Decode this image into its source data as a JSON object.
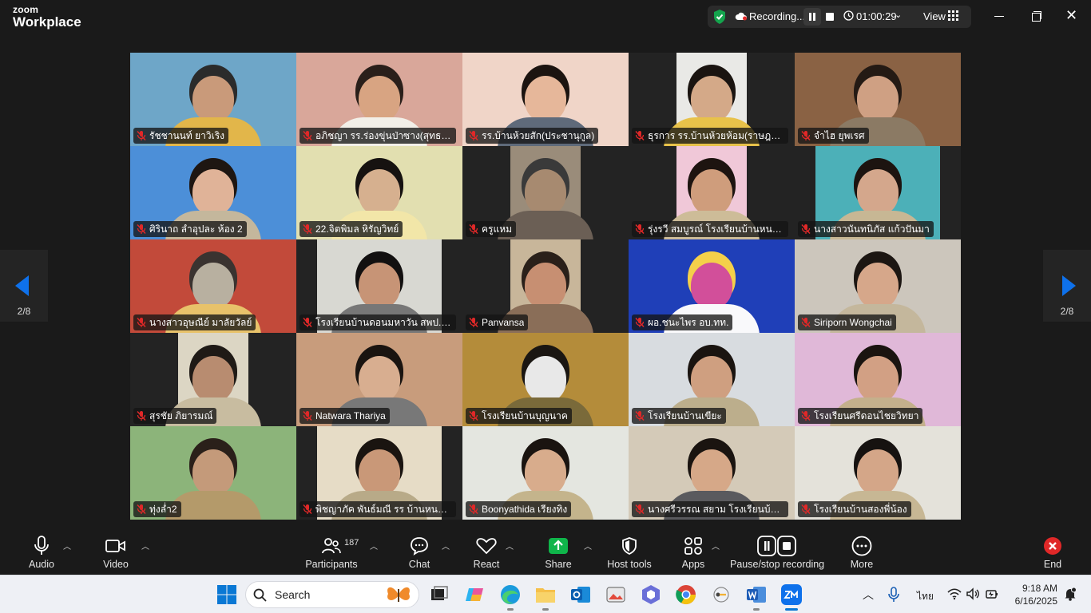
{
  "app": {
    "logo_line1": "zoom",
    "logo_line2": "Workplace"
  },
  "recording": {
    "label": "Recording...",
    "timer": "01:00:29",
    "view_label": "View"
  },
  "pagination": {
    "left": "2/8",
    "right": "2/8"
  },
  "participants": [
    {
      "name": "รัชชานนท์ ยาวิเริง"
    },
    {
      "name": "อภิชญา รร.ร่องขุ่นป่าซาง(สุทธานุสรณ์)"
    },
    {
      "name": "รร.บ้านห้วยสัก(ประชานุกูล)"
    },
    {
      "name": "ธุรการ รร.บ้านห้วยห้อม(ราษฎร์สามัคคี)"
    },
    {
      "name": "จำไฮ ยุพเรศ"
    },
    {
      "name": "ศิรินาถ ลำอุปละ ห้อง 2"
    },
    {
      "name": "22.จิตพิมล หิรัญวิทย์"
    },
    {
      "name": "ครูแหม"
    },
    {
      "name": "รุ่งรวี สมบูรณ์ โรงเรียนบ้านหนองบัว"
    },
    {
      "name": "นางสาวนันทนิภัส แก้วปันมา"
    },
    {
      "name": "นางสาวอุษณีย์ มาลัยวัลย์"
    },
    {
      "name": "โรงเรียนบ้านดอนมหาวัน สพป.เชียงราย"
    },
    {
      "name": "Panvansa"
    },
    {
      "name": "ผอ.ชนะไพร อบ.ทท."
    },
    {
      "name": "Siriporn Wongchai"
    },
    {
      "name": "สุรชัย ภิยารมณ์"
    },
    {
      "name": "Natwara Thariya"
    },
    {
      "name": "โรงเรียนบ้านบุญนาค"
    },
    {
      "name": "โรงเรียนบ้านเขียะ"
    },
    {
      "name": "โรงเรียนศรีดอนไชยวิทยา"
    },
    {
      "name": "ทุ่งล่ำ2"
    },
    {
      "name": "พิชญาภัค พันธ์มณี รร บ้านหนองเสา"
    },
    {
      "name": "Boonyathida เรียงทิง"
    },
    {
      "name": "นางศรีวรรณ สยาม โรงเรียนบ้านต้า"
    },
    {
      "name": "โรงเรียนบ้านสองพี่น้อง"
    }
  ],
  "toolbar": {
    "audio": "Audio",
    "video": "Video",
    "participants": "Participants",
    "participants_count": "187",
    "chat": "Chat",
    "react": "React",
    "share": "Share",
    "host_tools": "Host tools",
    "apps": "Apps",
    "pause_stop": "Pause/stop recording",
    "more": "More",
    "end": "End"
  },
  "taskbar": {
    "search_label": "Search",
    "language": "ไทย",
    "time": "9:18 AM",
    "date": "6/16/2025"
  },
  "colors": {
    "accent": "#0e71eb",
    "share_green": "#0fb54a",
    "muted_red": "#e02828",
    "end_red": "#e02828",
    "recording_shield": "#14a44d"
  }
}
